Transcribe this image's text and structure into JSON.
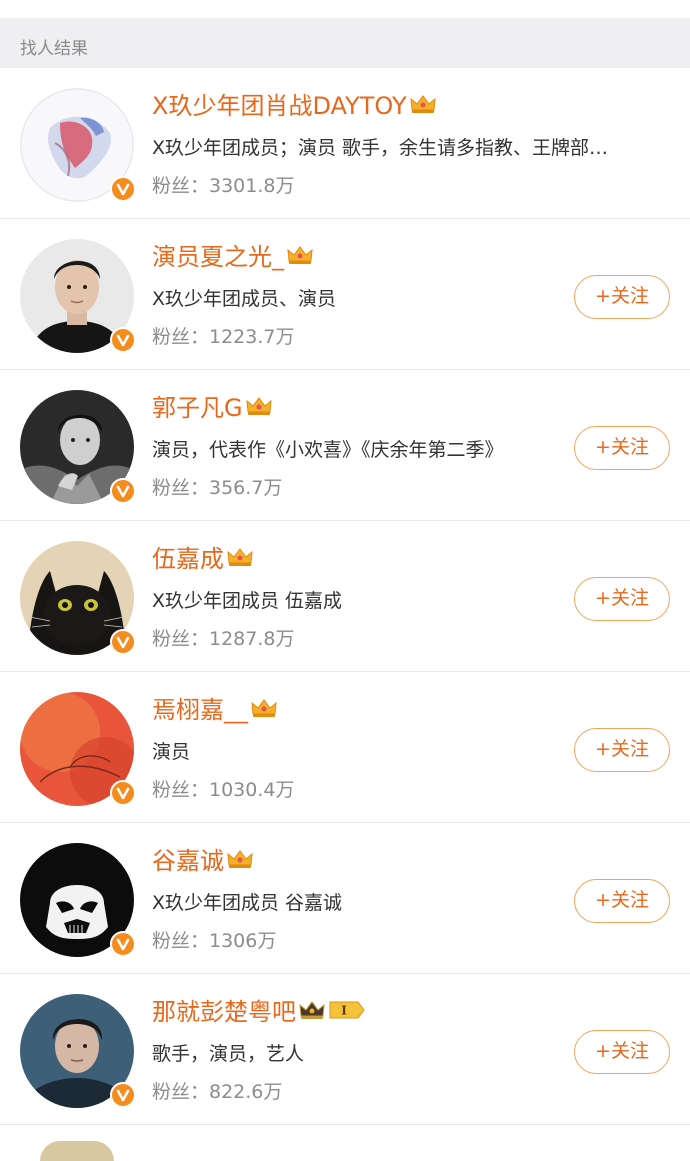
{
  "section": {
    "title": "找人结果"
  },
  "results": [
    {
      "name": "X玖少年团肖战DAYTOY",
      "desc": "X玖少年团成员；演员 歌手，余生请多指教、王牌部…",
      "fans": "粉丝：3301.8万",
      "follow": null
    },
    {
      "name": "演员夏之光_",
      "desc": "X玖少年团成员、演员",
      "fans": "粉丝：1223.7万",
      "follow": "+关注"
    },
    {
      "name": "郭子凡G",
      "desc": "演员，代表作《小欢喜》《庆余年第二季》",
      "fans": "粉丝：356.7万",
      "follow": "+关注"
    },
    {
      "name": "伍嘉成",
      "desc": "X玖少年团成员 伍嘉成",
      "fans": "粉丝：1287.8万",
      "follow": "+关注"
    },
    {
      "name": "焉栩嘉__",
      "desc": "演员",
      "fans": "粉丝：1030.4万",
      "follow": "+关注"
    },
    {
      "name": "谷嘉诚",
      "desc": "X玖少年团成员 谷嘉诚",
      "fans": "粉丝：1306万",
      "follow": "+关注"
    },
    {
      "name": "那就彭楚粤吧",
      "desc": "歌手，演员，艺人",
      "fans": "粉丝：822.6万",
      "follow": "+关注",
      "rank_label": "I"
    }
  ],
  "colors": {
    "accent": "#e8681b",
    "badge": "#f68b1e",
    "crown": "#f5b02a",
    "header_bg": "#efeff1"
  },
  "icons": {
    "verified": "verified-v-icon",
    "member_crown": "vip-crown-icon",
    "rank_badge": "rank-badge-icon"
  }
}
